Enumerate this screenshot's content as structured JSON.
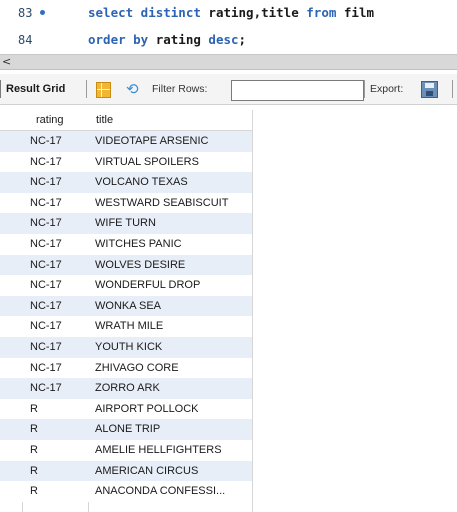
{
  "editor": {
    "lines": [
      {
        "number": "83",
        "parts": [
          {
            "t": "select distinct ",
            "c": "kw"
          },
          {
            "t": "rating,title ",
            "c": "id"
          },
          {
            "t": "from ",
            "c": "kw"
          },
          {
            "t": "film",
            "c": "id"
          }
        ]
      },
      {
        "number": "84",
        "parts": [
          {
            "t": "order by ",
            "c": "kw"
          },
          {
            "t": "rating ",
            "c": "id"
          },
          {
            "t": "desc",
            "c": "kw"
          },
          {
            "t": ";",
            "c": "id"
          }
        ]
      }
    ]
  },
  "scrollbar": {
    "left_arrow": "<"
  },
  "toolbar": {
    "result_grid": "Result Grid",
    "filter_rows": "Filter Rows:",
    "filter_value": "",
    "export": "Export:"
  },
  "icons": {
    "grid": "grid-icon",
    "refresh": "refresh-icon",
    "export": "export-icon"
  },
  "grid": {
    "columns": [
      "rating",
      "title"
    ],
    "rows": [
      [
        "NC-17",
        "VIDEOTAPE ARSENIC"
      ],
      [
        "NC-17",
        "VIRTUAL SPOILERS"
      ],
      [
        "NC-17",
        "VOLCANO TEXAS"
      ],
      [
        "NC-17",
        "WESTWARD SEABISCUIT"
      ],
      [
        "NC-17",
        "WIFE TURN"
      ],
      [
        "NC-17",
        "WITCHES PANIC"
      ],
      [
        "NC-17",
        "WOLVES DESIRE"
      ],
      [
        "NC-17",
        "WONDERFUL DROP"
      ],
      [
        "NC-17",
        "WONKA SEA"
      ],
      [
        "NC-17",
        "WRATH MILE"
      ],
      [
        "NC-17",
        "YOUTH KICK"
      ],
      [
        "NC-17",
        "ZHIVAGO CORE"
      ],
      [
        "NC-17",
        "ZORRO ARK"
      ],
      [
        "R",
        "AIRPORT POLLOCK"
      ],
      [
        "R",
        "ALONE TRIP"
      ],
      [
        "R",
        "AMELIE HELLFIGHTERS"
      ],
      [
        "R",
        "AMERICAN CIRCUS"
      ],
      [
        "R",
        "ANACONDA CONFESSI..."
      ]
    ]
  },
  "colors": {
    "keyword": "#2c64b4",
    "row_alt": "#e8eef8"
  }
}
